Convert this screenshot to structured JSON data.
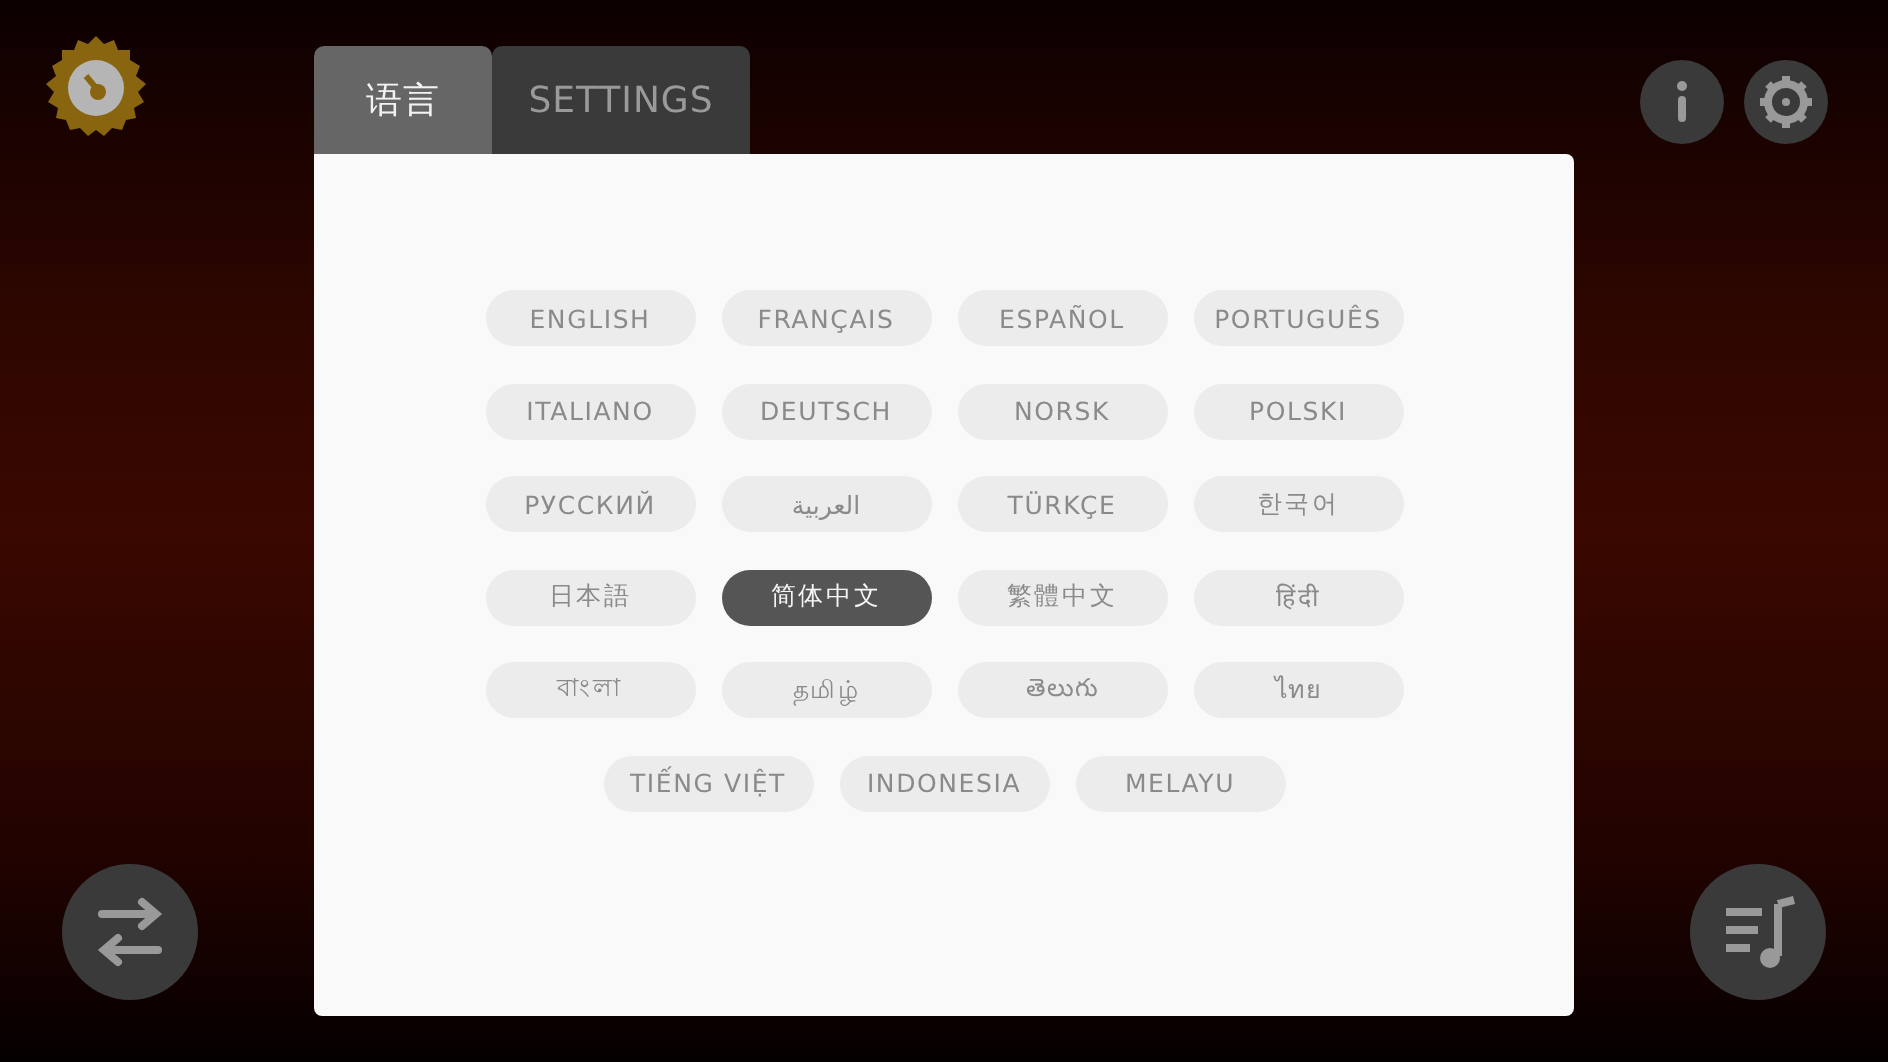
{
  "tabs": [
    {
      "label": "语言",
      "selected": true
    },
    {
      "label": "SETTINGS",
      "selected": false
    }
  ],
  "languages": [
    {
      "label": "ENGLISH",
      "selected": false
    },
    {
      "label": "FRANÇAIS",
      "selected": false
    },
    {
      "label": "ESPAÑOL",
      "selected": false
    },
    {
      "label": "PORTUGUÊS",
      "selected": false
    },
    {
      "label": "ITALIANO",
      "selected": false
    },
    {
      "label": "DEUTSCH",
      "selected": false
    },
    {
      "label": "NORSK",
      "selected": false
    },
    {
      "label": "POLSKI",
      "selected": false
    },
    {
      "label": "РУССКИЙ",
      "selected": false
    },
    {
      "label": "العربية",
      "selected": false
    },
    {
      "label": "TÜRKÇE",
      "selected": false
    },
    {
      "label": "한국어",
      "selected": false
    },
    {
      "label": "日本語",
      "selected": false
    },
    {
      "label": "简体中文",
      "selected": true
    },
    {
      "label": "繁體中文",
      "selected": false
    },
    {
      "label": "हिंदी",
      "selected": false
    },
    {
      "label": "বাংলা",
      "selected": false
    },
    {
      "label": "தமிழ்",
      "selected": false
    },
    {
      "label": "తెలుగు",
      "selected": false
    },
    {
      "label": "ไทย",
      "selected": false
    },
    {
      "label": "TIẾNG VIỆT",
      "selected": false
    },
    {
      "label": "INDONESIA",
      "selected": false
    },
    {
      "label": "MELAYU",
      "selected": false
    }
  ]
}
